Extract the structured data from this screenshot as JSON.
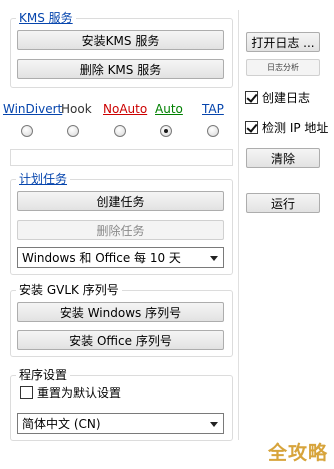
{
  "kms_group": {
    "legend": "KMS 服务",
    "install_label": "安装KMS 服务",
    "delete_label": "删除 KMS 服务"
  },
  "right_panel": {
    "open_log_label": "打开日志 ...",
    "log_analysis_label": "日志分析",
    "create_log_label": "创建日志",
    "create_log_checked": true,
    "detect_ip_label": "检测 IP 地址",
    "detect_ip_checked": true,
    "clear_label": "清除",
    "run_label": "运行"
  },
  "mode_tabs": [
    {
      "label": "WinDivert",
      "color": "#0645ad",
      "underline": true,
      "selected": false
    },
    {
      "label": "Hook",
      "color": "#333333",
      "underline": false,
      "selected": false
    },
    {
      "label": "NoAuto",
      "color": "#cc0000",
      "underline": true,
      "selected": false
    },
    {
      "label": "Auto",
      "color": "#008000",
      "underline": true,
      "selected": true
    },
    {
      "label": "TAP",
      "color": "#0645ad",
      "underline": true,
      "selected": false
    }
  ],
  "task_group": {
    "legend": "计划任务",
    "create_label": "创建任务",
    "delete_label": "删除任务",
    "schedule_value": "Windows 和 Office 每 10 天"
  },
  "gvlk_group": {
    "legend": "安装 GVLK 序列号",
    "windows_label": "安装 Windows 序列号",
    "office_label": "安装 Office 序列号"
  },
  "settings_group": {
    "legend": "程序设置",
    "reset_label": "重置为默认设置",
    "reset_checked": false,
    "language_value": "简体中文 (CN)"
  },
  "watermark": "全攻略"
}
